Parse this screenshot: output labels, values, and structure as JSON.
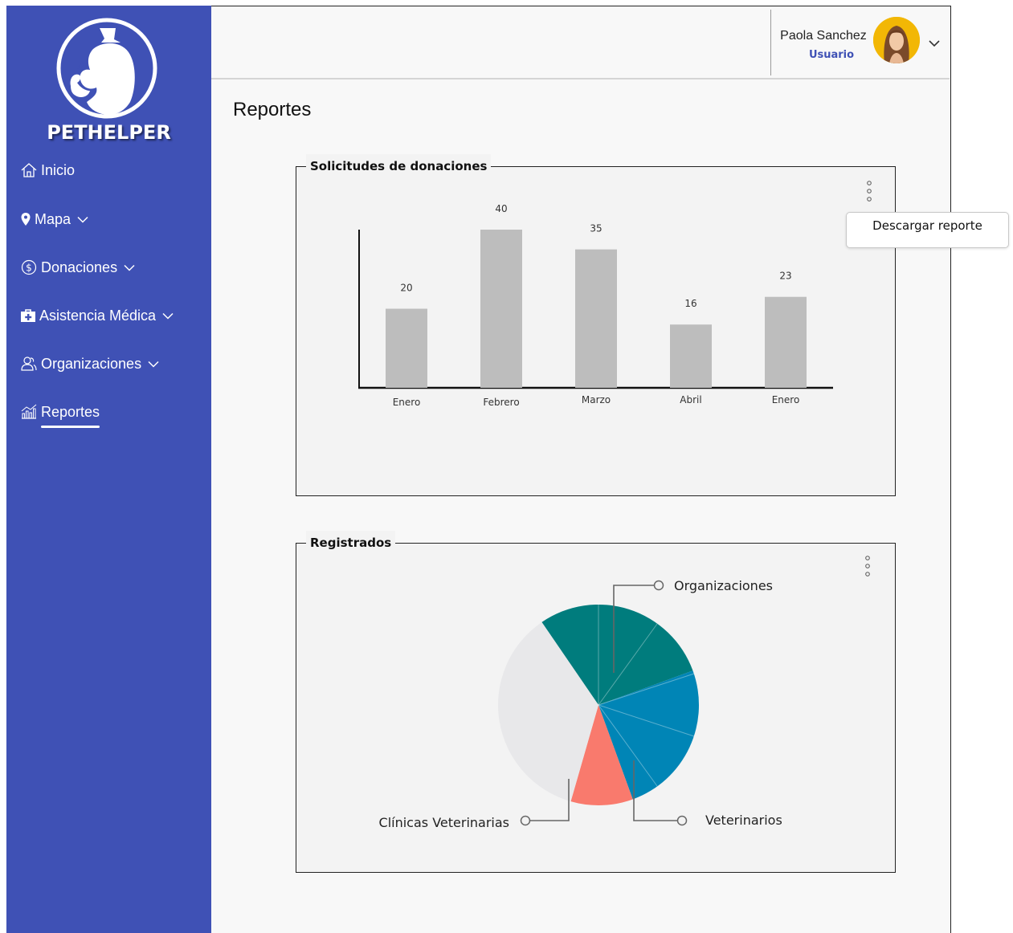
{
  "brand": {
    "name": "PETHELPER"
  },
  "nav": {
    "items": [
      {
        "label": "Inicio",
        "icon": "home-icon",
        "has_submenu": false
      },
      {
        "label": "Mapa",
        "icon": "map-pin-icon",
        "has_submenu": true
      },
      {
        "label": "Donaciones",
        "icon": "dollar-circle-icon",
        "has_submenu": true
      },
      {
        "label": "Asistencia Médica",
        "icon": "medical-kit-icon",
        "has_submenu": true
      },
      {
        "label": "Organizaciones",
        "icon": "users-icon",
        "has_submenu": true
      },
      {
        "label": "Reportes",
        "icon": "bar-chart-icon",
        "has_submenu": false,
        "active": true
      }
    ]
  },
  "user": {
    "name": "Paola Sanchez",
    "role": "Usuario"
  },
  "page": {
    "title": "Reportes"
  },
  "menu": {
    "download_label": "Descargar reporte"
  },
  "colors": {
    "sidebar": "#3f51b5",
    "bar": "#bdbdbd",
    "pie_teal": "#007c7d",
    "pie_blue": "#0085b6",
    "pie_coral": "#f97a6d",
    "pie_gray": "#e8e8ea"
  },
  "chart_data": [
    {
      "type": "bar",
      "title": "Solicitudes de donaciones",
      "categories": [
        "Enero",
        "Febrero",
        "Marzo",
        "Abril",
        "Enero"
      ],
      "values": [
        20,
        40,
        35,
        16,
        23
      ],
      "ylim": [
        0,
        40
      ],
      "grid": false,
      "legend": "none"
    },
    {
      "type": "pie",
      "title": "Registrados",
      "labels": [
        "Organizaciones",
        "Veterinarios",
        "Clínicas Veterinarias"
      ],
      "values": [
        0.29,
        0.25,
        0.1,
        0.36
      ],
      "slice_colors": [
        "#007c7d",
        "#0085b6",
        "#f97a6d",
        "#e8e8ea"
      ],
      "legend": "callouts"
    }
  ]
}
